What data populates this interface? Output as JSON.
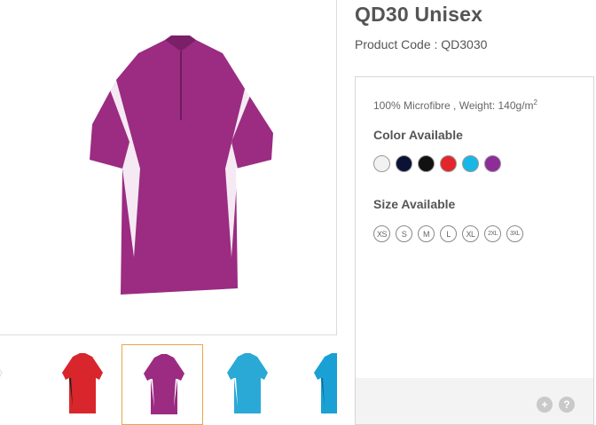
{
  "product": {
    "title": "QD30 Unisex",
    "code_label": "Product Code : QD3030"
  },
  "details": {
    "material": "100% Microfibre , Weight: 140g/m",
    "material_sup": "2",
    "color_heading": "Color Available",
    "size_heading": "Size Available"
  },
  "colors": [
    "#f2f2f2",
    "#0b1236",
    "#111111",
    "#e3262b",
    "#19b7e6",
    "#8e2c9a"
  ],
  "sizes": [
    "XS",
    "S",
    "M",
    "L",
    "XL",
    "2XL",
    "3XL"
  ],
  "thumbnails": [
    {
      "color": "#ffffff",
      "accent": "#dddddd"
    },
    {
      "color": "#d8262c",
      "accent": "#222222"
    },
    {
      "color": "#9b2c82",
      "accent": "#ffffff"
    },
    {
      "color": "#2aa9d6",
      "accent": "#ffffff"
    },
    {
      "color": "#1aa0d4",
      "accent": "#0f6f98"
    }
  ],
  "footer": {
    "add_icon": "+",
    "help_icon": "?"
  }
}
